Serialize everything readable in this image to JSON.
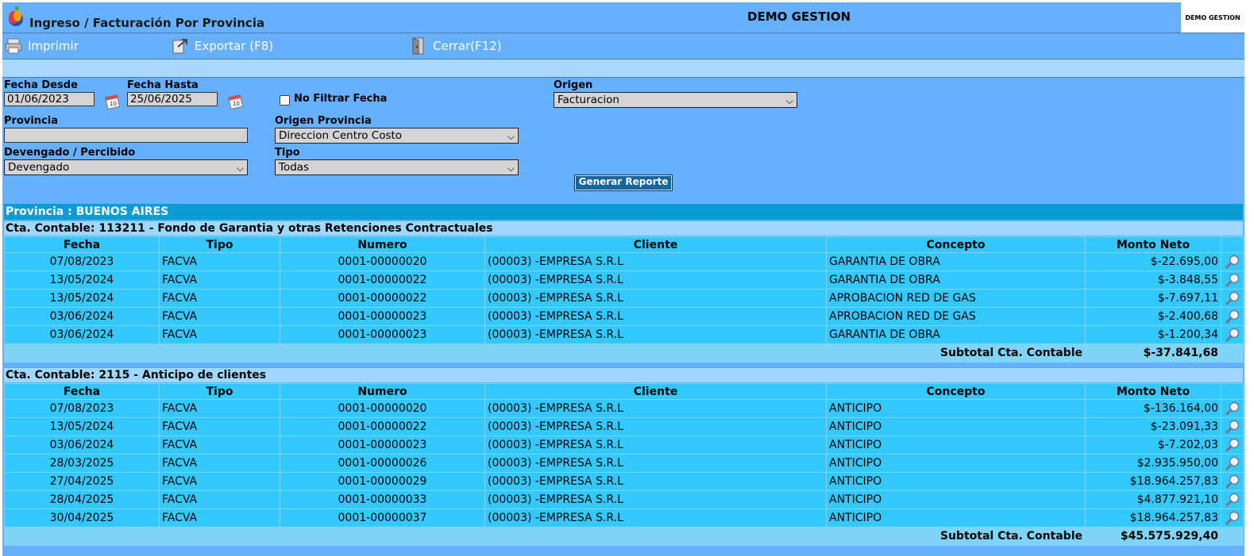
{
  "header": {
    "title": "Ingreso / Facturación Por Provincia",
    "company": "DEMO GESTION",
    "logo_text": "DEMO GESTION"
  },
  "toolbar": {
    "print_label": "Imprimir",
    "export_label": "Exportar (F8)",
    "close_label": "Cerrar(F12)"
  },
  "filters": {
    "fecha_desde_label": "Fecha Desde",
    "fecha_desde_value": "01/06/2023",
    "fecha_hasta_label": "Fecha Hasta",
    "fecha_hasta_value": "25/06/2025",
    "no_filtrar_label": "No Filtrar Fecha",
    "origen_label": "Origen",
    "origen_value": "Facturacion",
    "provincia_label": "Provincia",
    "provincia_value": "",
    "origen_provincia_label": "Origen Provincia",
    "origen_provincia_value": "Direccion Centro Costo",
    "devengado_label": "Devengado / Percibido",
    "devengado_value": "Devengado",
    "tipo_label": "Tipo",
    "tipo_value": "Todas",
    "generate_label": "Generar Reporte"
  },
  "report": {
    "provincia_title": "Provincia : BUENOS AIRES",
    "columns": [
      "Fecha",
      "Tipo",
      "Numero",
      "Cliente",
      "Concepto",
      "Monto Neto"
    ],
    "subtotal_label": "Subtotal Cta. Contable",
    "groups": [
      {
        "title": "Cta. Contable: 113211 - Fondo de Garantia y otras Retenciones Contractuales",
        "rows": [
          {
            "fecha": "07/08/2023",
            "tipo": "FACVA",
            "numero": "0001-00000020",
            "cliente": "(00003) -EMPRESA S.R.L",
            "concepto": "GARANTIA DE OBRA",
            "monto": "$-22.695,00"
          },
          {
            "fecha": "13/05/2024",
            "tipo": "FACVA",
            "numero": "0001-00000022",
            "cliente": "(00003) -EMPRESA S.R.L",
            "concepto": "GARANTIA DE OBRA",
            "monto": "$-3.848,55"
          },
          {
            "fecha": "13/05/2024",
            "tipo": "FACVA",
            "numero": "0001-00000022",
            "cliente": "(00003) -EMPRESA S.R.L",
            "concepto": "APROBACION RED DE GAS",
            "monto": "$-7.697,11"
          },
          {
            "fecha": "03/06/2024",
            "tipo": "FACVA",
            "numero": "0001-00000023",
            "cliente": "(00003) -EMPRESA S.R.L",
            "concepto": "APROBACION RED DE GAS",
            "monto": "$-2.400,68"
          },
          {
            "fecha": "03/06/2024",
            "tipo": "FACVA",
            "numero": "0001-00000023",
            "cliente": "(00003) -EMPRESA S.R.L",
            "concepto": "GARANTIA DE OBRA",
            "monto": "$-1.200,34"
          }
        ],
        "subtotal": "$-37.841,68"
      },
      {
        "title": "Cta. Contable: 2115 - Anticipo de clientes",
        "rows": [
          {
            "fecha": "07/08/2023",
            "tipo": "FACVA",
            "numero": "0001-00000020",
            "cliente": "(00003) -EMPRESA S.R.L",
            "concepto": "ANTICIPO",
            "monto": "$-136.164,00"
          },
          {
            "fecha": "13/05/2024",
            "tipo": "FACVA",
            "numero": "0001-00000022",
            "cliente": "(00003) -EMPRESA S.R.L",
            "concepto": "ANTICIPO",
            "monto": "$-23.091,33"
          },
          {
            "fecha": "03/06/2024",
            "tipo": "FACVA",
            "numero": "0001-00000023",
            "cliente": "(00003) -EMPRESA S.R.L",
            "concepto": "ANTICIPO",
            "monto": "$-7.202,03"
          },
          {
            "fecha": "28/03/2025",
            "tipo": "FACVA",
            "numero": "0001-00000026",
            "cliente": "(00003) -EMPRESA S.R.L",
            "concepto": "ANTICIPO",
            "monto": "$2.935.950,00"
          },
          {
            "fecha": "27/04/2025",
            "tipo": "FACVA",
            "numero": "0001-00000029",
            "cliente": "(00003) -EMPRESA S.R.L",
            "concepto": "ANTICIPO",
            "monto": "$18.964.257,83"
          },
          {
            "fecha": "28/04/2025",
            "tipo": "FACVA",
            "numero": "0001-00000033",
            "cliente": "(00003) -EMPRESA S.R.L",
            "concepto": "ANTICIPO",
            "monto": "$4.877.921,10"
          },
          {
            "fecha": "30/04/2025",
            "tipo": "FACVA",
            "numero": "0001-00000037",
            "cliente": "(00003) -EMPRESA S.R.L",
            "concepto": "ANTICIPO",
            "monto": "$18.964.257,83"
          }
        ],
        "subtotal": "$45.575.929,40"
      }
    ]
  },
  "colors": {
    "background": "#66b0ff",
    "provincia_bar": "#0a9cd4",
    "table_cell": "#33c8ff",
    "subtotal_row": "#7fd3f5",
    "button": "#1565a0"
  }
}
